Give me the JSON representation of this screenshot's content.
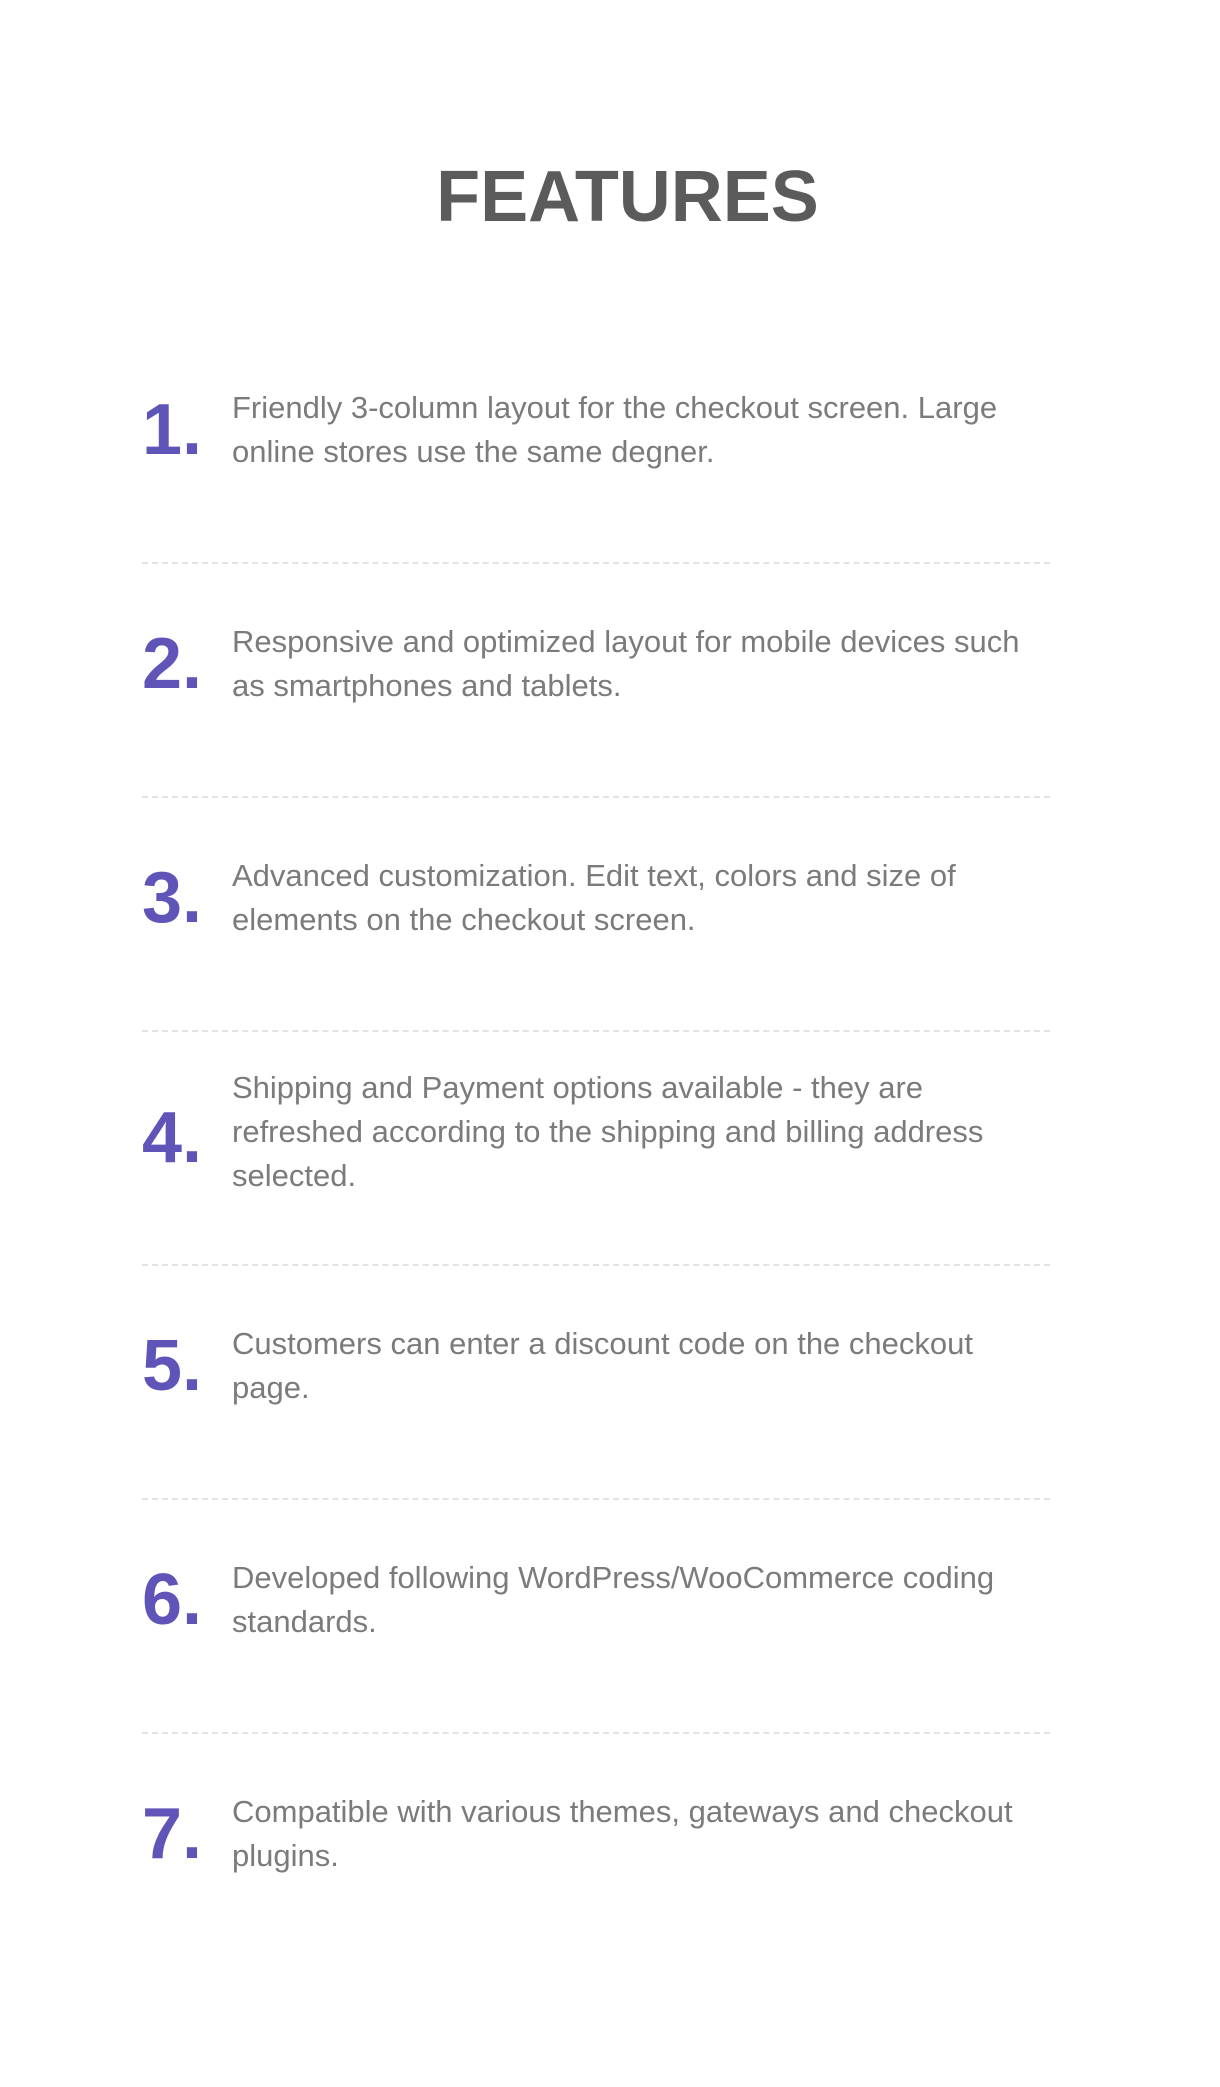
{
  "header": {
    "title": "FEATURES"
  },
  "features": [
    {
      "number": "1.",
      "text": "Friendly 3-column layout for the checkout screen. Large online stores use the same degner."
    },
    {
      "number": "2.",
      "text": "Responsive and optimized layout for mobile devices such as smartphones and tablets."
    },
    {
      "number": "3.",
      "text": "Advanced customization. Edit text, colors and size of elements on the checkout screen."
    },
    {
      "number": "4.",
      "text": "Shipping and Payment options available - they are refreshed according to the shipping and billing address selected."
    },
    {
      "number": "5.",
      "text": "Customers can enter a discount code on the checkout page."
    },
    {
      "number": "6.",
      "text": "Developed following WordPress/WooCommerce coding standards."
    },
    {
      "number": "7.",
      "text": "Compatible with various themes, gateways and checkout plugins."
    }
  ],
  "colors": {
    "accent": "#5f55b8",
    "title": "#5b5b5b",
    "body_text": "#7b7b7b",
    "divider": "#e3e3e3",
    "background": "#ffffff"
  }
}
